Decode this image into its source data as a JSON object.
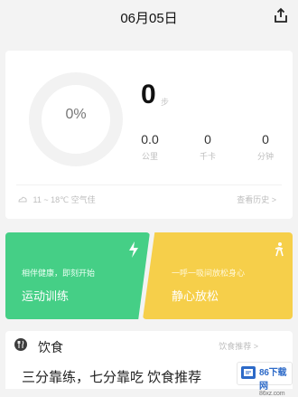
{
  "header": {
    "date": "06月05日"
  },
  "summary": {
    "progress_text": "0%",
    "progress_fraction": 0,
    "big_value": "0",
    "big_unit": "步",
    "stats": [
      {
        "value": "0.0",
        "label": "公里"
      },
      {
        "value": "0",
        "label": "千卡"
      },
      {
        "value": "0",
        "label": "分钟"
      }
    ],
    "weather_text": "11 ~ 18℃ 空气佳",
    "history_link": "查看历史 >"
  },
  "cards": {
    "training": {
      "subtitle": "相伴健康，即刻开始",
      "title": "运动训练"
    },
    "relax": {
      "subtitle": "一呼一吸间放松身心",
      "title": "静心放松"
    }
  },
  "diet": {
    "title": "饮食",
    "link": "饮食推荐 >",
    "quote": "三分靠练，七分靠吃 饮食推荐"
  },
  "watermark": {
    "brand": "86下载网",
    "sub": "86xz.com"
  },
  "colors": {
    "accent_green": "#45cf86",
    "accent_yellow": "#f6cf4a"
  },
  "icons": {
    "share": "share-icon",
    "weather": "weather-icon",
    "training": "lightning-icon",
    "relax": "relax-icon",
    "diet": "cutlery-icon"
  }
}
